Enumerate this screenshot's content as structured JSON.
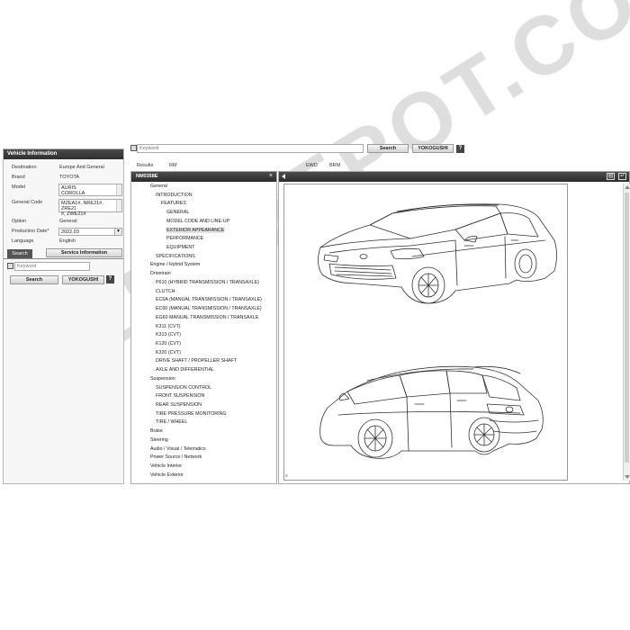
{
  "vehicle_info": {
    "title": "Vehicle Information",
    "rows": [
      {
        "label": "Destination",
        "value": "Europe And General"
      },
      {
        "label": "Brand",
        "value": "TOYOTA"
      },
      {
        "label": "Model",
        "value_lines": [
          "AURIS",
          "COROLLA"
        ]
      },
      {
        "label": "General Code",
        "value_lines": [
          "MZEA1#, NRE21#, ZRE21",
          "#, ZWE21#"
        ]
      },
      {
        "label": "Option",
        "value": "General"
      },
      {
        "label": "Production Date*",
        "value": "2022.03"
      },
      {
        "label": "Language",
        "value": "English"
      }
    ],
    "tab_search": "Search",
    "service_button": "Service Information",
    "keyword_placeholder": "Keyword",
    "search_button": "Search",
    "yokogushi_button": "YOKOGUSHI",
    "help": "?"
  },
  "toolbar": {
    "keyword_placeholder": "Keyword",
    "search_button": "Search",
    "yokogushi_button": "YOKOGUSHI",
    "help": "?"
  },
  "results": {
    "label": "Results",
    "rm": "RM",
    "ewd": "EWD",
    "brm": "BRM"
  },
  "tree": {
    "header": "NM0358E",
    "items": [
      {
        "text": "General",
        "level": 0
      },
      {
        "text": "INTRODUCTION",
        "level": 1
      },
      {
        "text": "FEATURES",
        "level": 2
      },
      {
        "text": "GENERAL",
        "level": 3
      },
      {
        "text": "MODEL CODE AND LINE-UP",
        "level": 3
      },
      {
        "text": "EXTERIOR APPEARANCE",
        "level": 3,
        "selected": true
      },
      {
        "text": "PERFORMANCE",
        "level": 3
      },
      {
        "text": "EQUIPMENT",
        "level": 3
      },
      {
        "text": "SPECIFICATIONS",
        "level": 1
      },
      {
        "text": "Engine / Hybrid System",
        "level": 0
      },
      {
        "text": "Drivetrain",
        "level": 0
      },
      {
        "text": "P610 (HYBRID TRANSMISSION / TRANSAXLE)",
        "level": 1
      },
      {
        "text": "CLUTCH",
        "level": 1
      },
      {
        "text": "EC6A (MANUAL TRANSMISSION / TRANSAXLE)",
        "level": 1
      },
      {
        "text": "EC60 (MANUAL TRANSMISSION / TRANSAXLE)",
        "level": 1
      },
      {
        "text": "EG60 MANUAL TRANSMISSION / TRANSAXLE",
        "level": 1
      },
      {
        "text": "K311 (CVT)",
        "level": 1
      },
      {
        "text": "K313 (CVT)",
        "level": 1
      },
      {
        "text": "K120 (CVT)",
        "level": 1
      },
      {
        "text": "K320 (CVT)",
        "level": 1
      },
      {
        "text": "DRIVE SHAFT / PROPELLER SHAFT",
        "level": 1
      },
      {
        "text": "AXLE AND DIFFERENTIAL",
        "level": 1
      },
      {
        "text": "Suspension",
        "level": 0
      },
      {
        "text": "SUSPENSION CONTROL",
        "level": 1
      },
      {
        "text": "FRONT SUSPENSION",
        "level": 1
      },
      {
        "text": "REAR SUSPENSION",
        "level": 1
      },
      {
        "text": "TIRE PRESSURE MONITORING",
        "level": 1
      },
      {
        "text": "TIRE / WHEEL",
        "level": 1
      },
      {
        "text": "Brake",
        "level": 0
      },
      {
        "text": "Steering",
        "level": 0
      },
      {
        "text": "Audio / Visual / Telematics",
        "level": 0
      },
      {
        "text": "Power Source / Network",
        "level": 0
      },
      {
        "text": "Vehicle Interior",
        "level": 0
      },
      {
        "text": "Vehicle Exterior",
        "level": 0
      }
    ]
  },
  "viewer": {
    "corner_mark": "≡",
    "watermark": "EPCDEPOT.COM"
  },
  "colors": {
    "header_dark": "#333333",
    "panel_border": "#aaaaaa"
  }
}
